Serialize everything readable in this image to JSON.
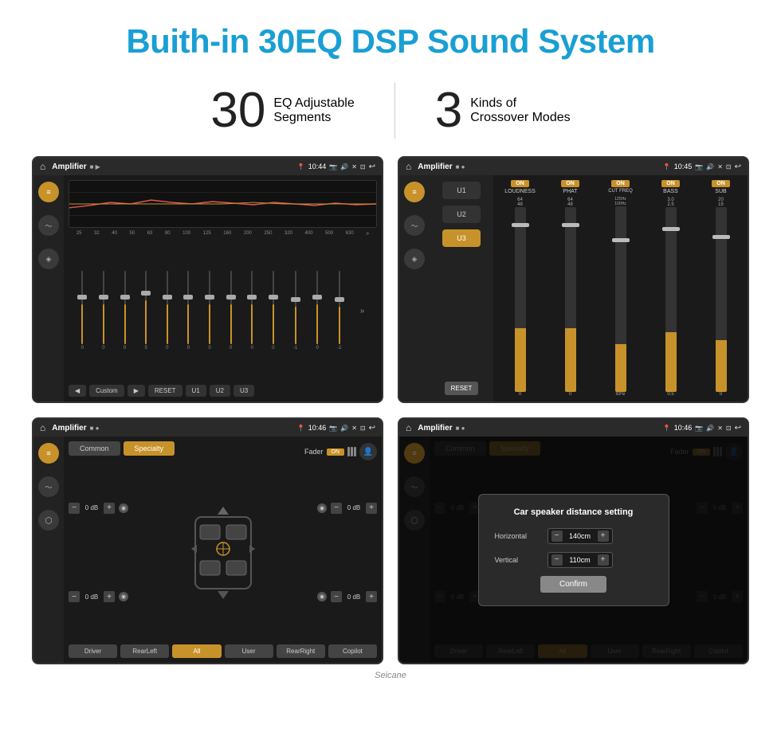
{
  "header": {
    "title": "Buith-in 30EQ DSP Sound System"
  },
  "stats": {
    "eq_number": "30",
    "eq_label_line1": "EQ Adjustable",
    "eq_label_line2": "Segments",
    "crossover_number": "3",
    "crossover_label_line1": "Kinds of",
    "crossover_label_line2": "Crossover Modes"
  },
  "screen1": {
    "app_name": "Amplifier",
    "time": "10:44",
    "freq_labels": [
      "25",
      "32",
      "40",
      "50",
      "63",
      "80",
      "100",
      "125",
      "160",
      "200",
      "250",
      "320",
      "400",
      "500",
      "630"
    ],
    "slider_values": [
      "0",
      "0",
      "0",
      "0",
      "5",
      "0",
      "0",
      "0",
      "0",
      "0",
      "0",
      "0",
      "-1",
      "0",
      "-1"
    ],
    "buttons": {
      "custom": "Custom",
      "reset": "RESET",
      "u1": "U1",
      "u2": "U2",
      "u3": "U3"
    }
  },
  "screen2": {
    "app_name": "Amplifier",
    "time": "10:45",
    "presets": [
      "U1",
      "U2",
      "U3"
    ],
    "active_preset": "U3",
    "channels": [
      "LOUDNESS",
      "PHAT",
      "CUT FREQ",
      "BASS",
      "SUB"
    ],
    "channel_on": [
      true,
      true,
      true,
      true,
      true
    ],
    "reset_label": "RESET"
  },
  "screen3": {
    "app_name": "Amplifier",
    "time": "10:46",
    "tabs": [
      "Common",
      "Specialty"
    ],
    "active_tab": "Specialty",
    "fader_label": "Fader",
    "fader_on": "ON",
    "vol_controls": {
      "fl": "0 dB",
      "fr": "0 dB",
      "rl": "0 dB",
      "rr": "0 dB"
    },
    "zone_buttons": [
      "Driver",
      "RearLeft",
      "All",
      "User",
      "RearRight",
      "Copilot"
    ],
    "active_zone": "All"
  },
  "screen4": {
    "app_name": "Amplifier",
    "time": "10:46",
    "dialog": {
      "title": "Car speaker distance setting",
      "horizontal_label": "Horizontal",
      "horizontal_value": "140cm",
      "vertical_label": "Vertical",
      "vertical_value": "110cm",
      "confirm_label": "Confirm"
    },
    "zone_buttons": [
      "Driver",
      "RearLeft",
      "All",
      "User",
      "RearRight",
      "Copilot"
    ]
  },
  "watermark": "Seicane"
}
